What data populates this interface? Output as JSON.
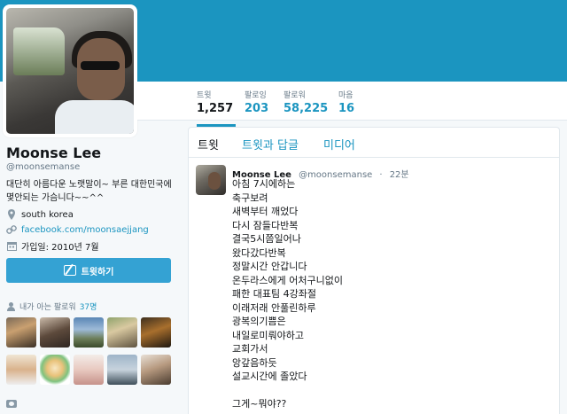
{
  "profile": {
    "name": "Moonse Lee",
    "handle": "@moonsemanse",
    "bio": "대단히 아름다운 노랫말이~ 부른 대한민국에 몇안되는 가슴니다~~^^",
    "location": "south korea",
    "website": "facebook.com/moonsaejjang",
    "joined": "가입일: 2010년 7월"
  },
  "nav": [
    {
      "label": "트윗",
      "value": "1,257",
      "active": true
    },
    {
      "label": "팔로잉",
      "value": "203"
    },
    {
      "label": "팔로워",
      "value": "58,225"
    },
    {
      "label": "마음",
      "value": "16"
    }
  ],
  "tweet_button_label": "트윗하기",
  "followers_known": {
    "label": "내가 아는 팔로워",
    "count": "37명"
  },
  "tabs": [
    "트윗",
    "트윗과 답글",
    "미디어"
  ],
  "tweet": {
    "name": "Moonse Lee",
    "handle": "@moonsemanse",
    "time": "22분",
    "lines": [
      "아침 7시에하는",
      "축구보려",
      "새벽부터 깨었다",
      "다시 잠들다반복",
      "결국5시쯤일어나",
      "왔다갔다반복",
      "정말시간 안갑니다",
      "온두라스에게 어처구니없이",
      "패한 대표팀 4강좌절",
      "이래저래 안풀린하루",
      "광복의기쁨은",
      "내일로미뤄야하고",
      "교회가서",
      "앙갚음하듯",
      "설교시간에 졸았다",
      "",
      "그게~뭐야??"
    ]
  },
  "icons": {
    "location": "map-pin-icon",
    "website": "link-icon",
    "joined": "calendar-icon",
    "tweet_button": "compose-icon",
    "followers_known": "person-icon",
    "bottom": "camera-icon"
  },
  "colors": {
    "banner": "#1b95c0",
    "link": "#1b95c0",
    "button": "#34a2d3",
    "background": "#f5f8fa"
  }
}
